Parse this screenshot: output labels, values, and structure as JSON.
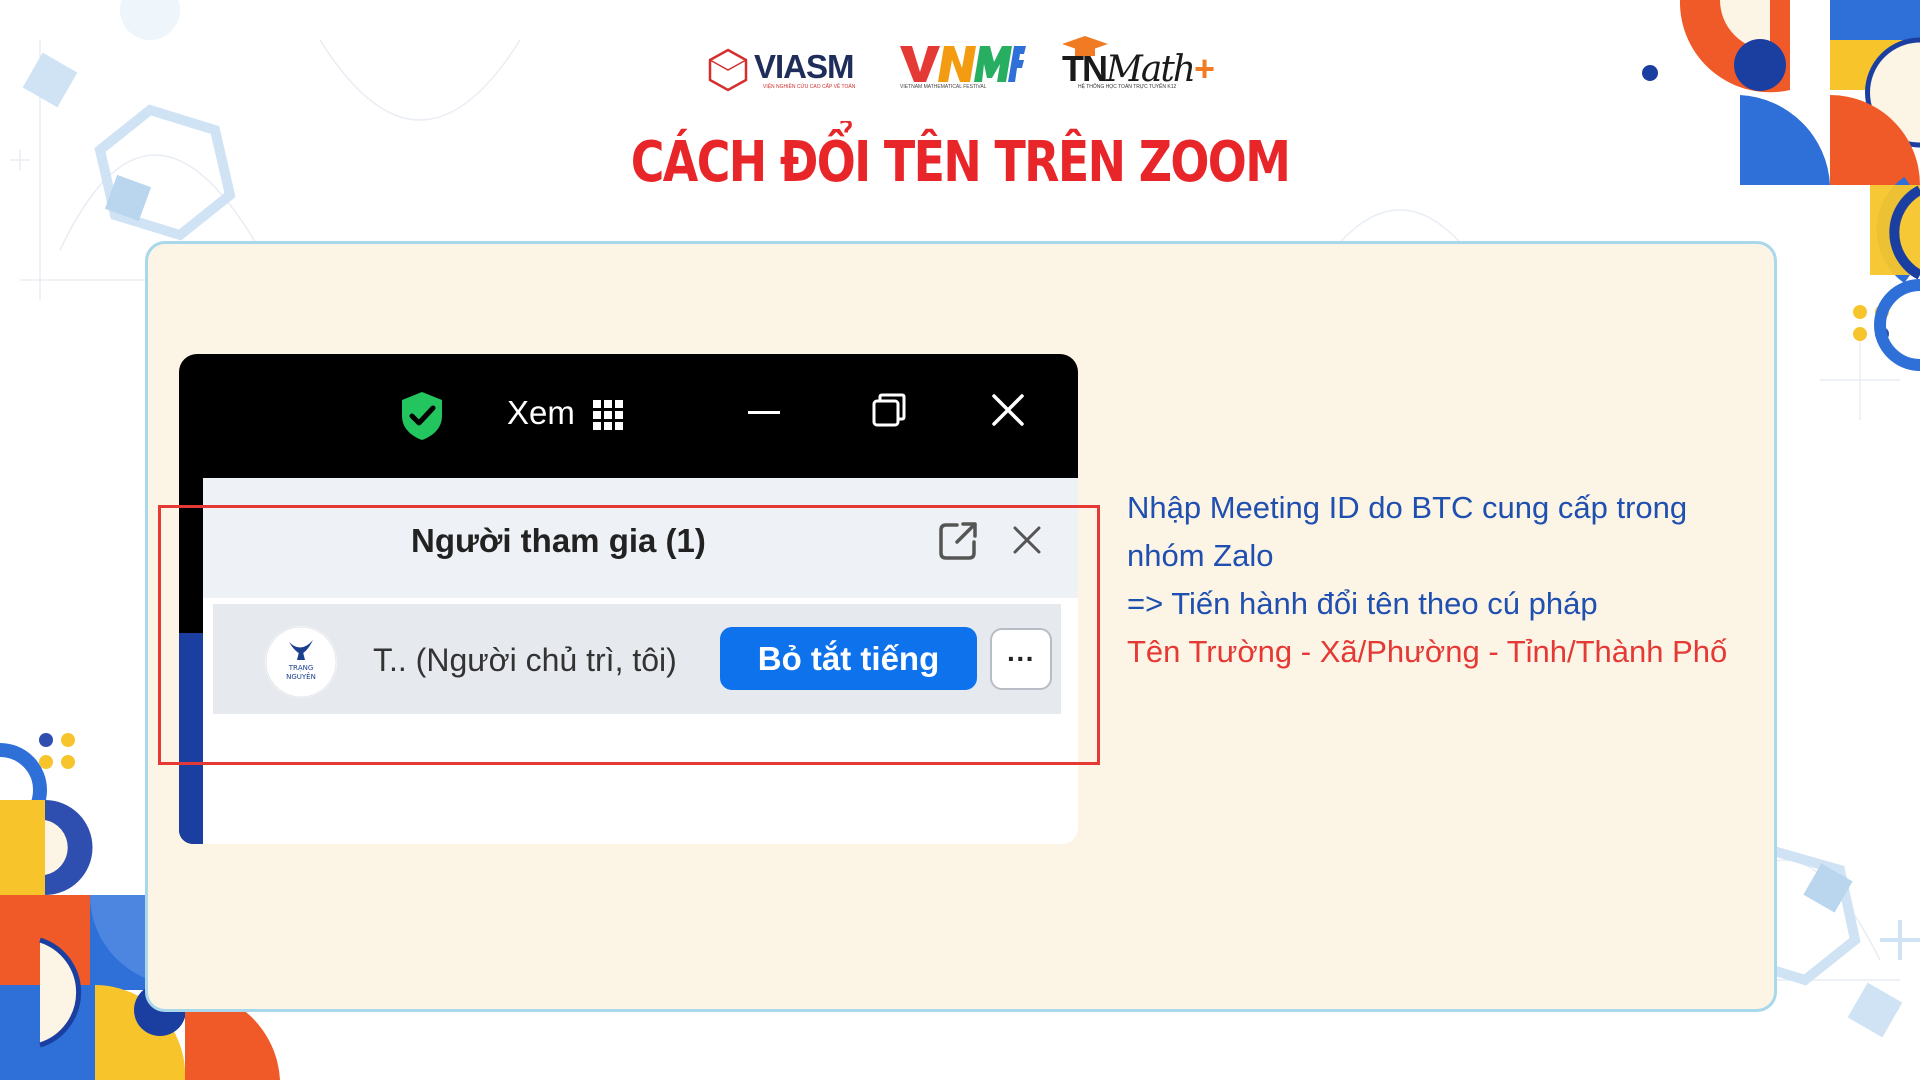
{
  "header": {
    "logos": {
      "viasm": {
        "word": "VIASM",
        "sub": "VIỆN NGHIÊN CỨU CAO CẤP VỀ TOÁN"
      },
      "vnmf": {
        "word": "VNMF",
        "sub": "VIETNAM MATHEMATICAL FESTIVAL"
      },
      "tnmath": {
        "word_prefix": "TN",
        "word_suffix": "Math",
        "plus": "+",
        "sub": "HỆ THỐNG HỌC TOÁN TRỰC TUYẾN K12"
      }
    },
    "title": "CÁCH ĐỔI TÊN TRÊN ZOOM"
  },
  "zoom": {
    "titlebar": {
      "view_label": "Xem",
      "icons": [
        "shield-check-icon",
        "grid-icon",
        "minimize-icon",
        "restore-icon",
        "close-icon"
      ]
    },
    "participants_panel": {
      "title": "Người tham gia (1)",
      "participant": {
        "avatar_text": [
          "TRẠNG",
          "NGUYÊN"
        ],
        "name": "T.. (Người chủ trì, tôi)",
        "mute_button": "Bỏ tắt tiếng",
        "more_button": "···"
      }
    }
  },
  "instructions": {
    "line1_words": [
      "Nhập",
      "Meeting",
      "ID",
      "do",
      "BTC",
      "cung",
      "cấp",
      "trong"
    ],
    "line2": "nhóm Zalo",
    "line3": "=> Tiến hành đổi tên theo cú pháp",
    "line4": "Tên Trường - Xã/Phường - Tỉnh/Thành Phố"
  },
  "colors": {
    "title_red": "#e8262a",
    "panel_bg": "#fcf4e4",
    "panel_border": "#a9d8ec",
    "zoom_blue": "#0e72ed",
    "instruction_blue": "#1f4fb0",
    "instruction_red": "#e53935",
    "highlight_red": "#e53935"
  }
}
